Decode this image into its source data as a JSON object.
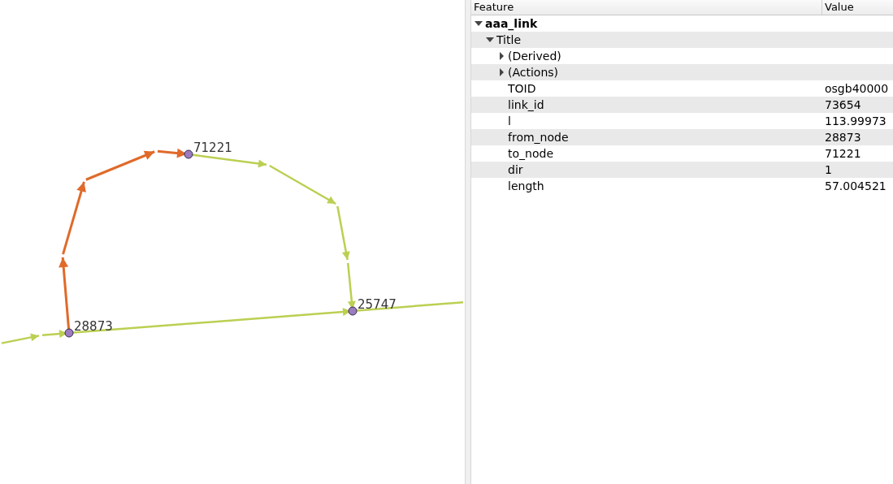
{
  "map": {
    "nodes": [
      {
        "label": "71221"
      },
      {
        "label": "28873"
      },
      {
        "label": "25747"
      }
    ],
    "links": [
      {
        "selected": true
      },
      {
        "selected": false
      },
      {
        "selected": false
      },
      {
        "selected": false
      },
      {
        "selected": false
      }
    ]
  },
  "panel": {
    "columns": [
      "Feature",
      "Value"
    ],
    "tree": [
      {
        "label": "aaa_link",
        "expanded": true,
        "children": [
          {
            "label": "Title",
            "expanded": true,
            "children": [
              {
                "label": "(Derived)",
                "expanded": false
              },
              {
                "label": "(Actions)",
                "expanded": false
              },
              {
                "label": "TOID",
                "value": "osgb40000"
              },
              {
                "label": "link_id",
                "value": "73654"
              },
              {
                "label": "l",
                "value": "113.99973"
              },
              {
                "label": "from_node",
                "value": "28873"
              },
              {
                "label": "to_node",
                "value": "71221"
              },
              {
                "label": "dir",
                "value": "1"
              },
              {
                "label": "length",
                "value": "57.004521"
              }
            ]
          }
        ]
      }
    ]
  }
}
